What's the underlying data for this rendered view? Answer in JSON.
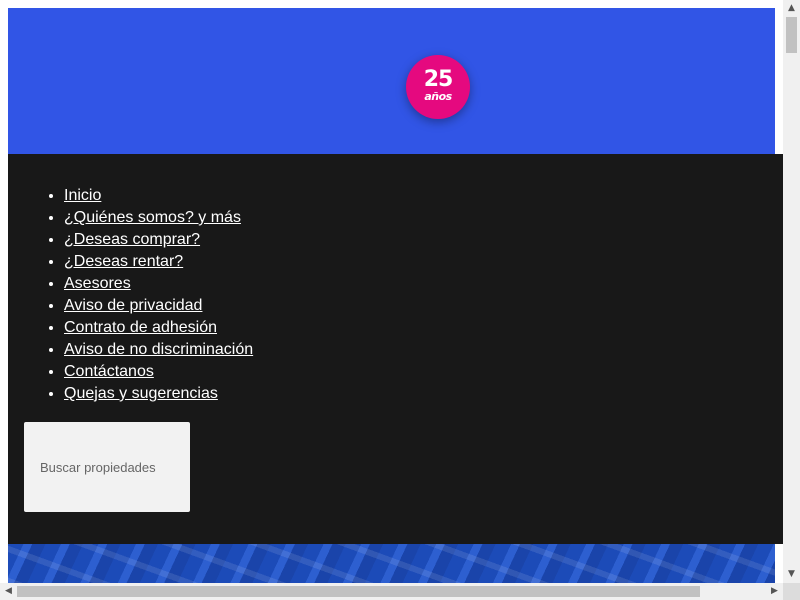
{
  "header": {
    "badge": {
      "number": "25",
      "word": "años"
    }
  },
  "nav": {
    "items": [
      {
        "label": "Inicio"
      },
      {
        "label": "¿Quiénes somos? y más"
      },
      {
        "label": "¿Deseas comprar?"
      },
      {
        "label": "¿Deseas rentar?"
      },
      {
        "label": "Asesores"
      },
      {
        "label": "Aviso de privacidad"
      },
      {
        "label": "Contrato de adhesión"
      },
      {
        "label": "Aviso de no discriminación"
      },
      {
        "label": "Contáctanos"
      },
      {
        "label": "Quejas y sugerencias"
      }
    ]
  },
  "search": {
    "placeholder": "Buscar propiedades",
    "value": ""
  },
  "icons": {
    "scroll_up": "triangle-up-icon",
    "scroll_down": "triangle-down-icon",
    "scroll_left": "triangle-left-icon",
    "scroll_right": "triangle-right-icon"
  },
  "colors": {
    "header_bg": "#3155e6",
    "badge_bg": "#e5097f",
    "menu_bg": "#181818",
    "link": "#ffffff",
    "search_bg": "#f2f2f2"
  }
}
